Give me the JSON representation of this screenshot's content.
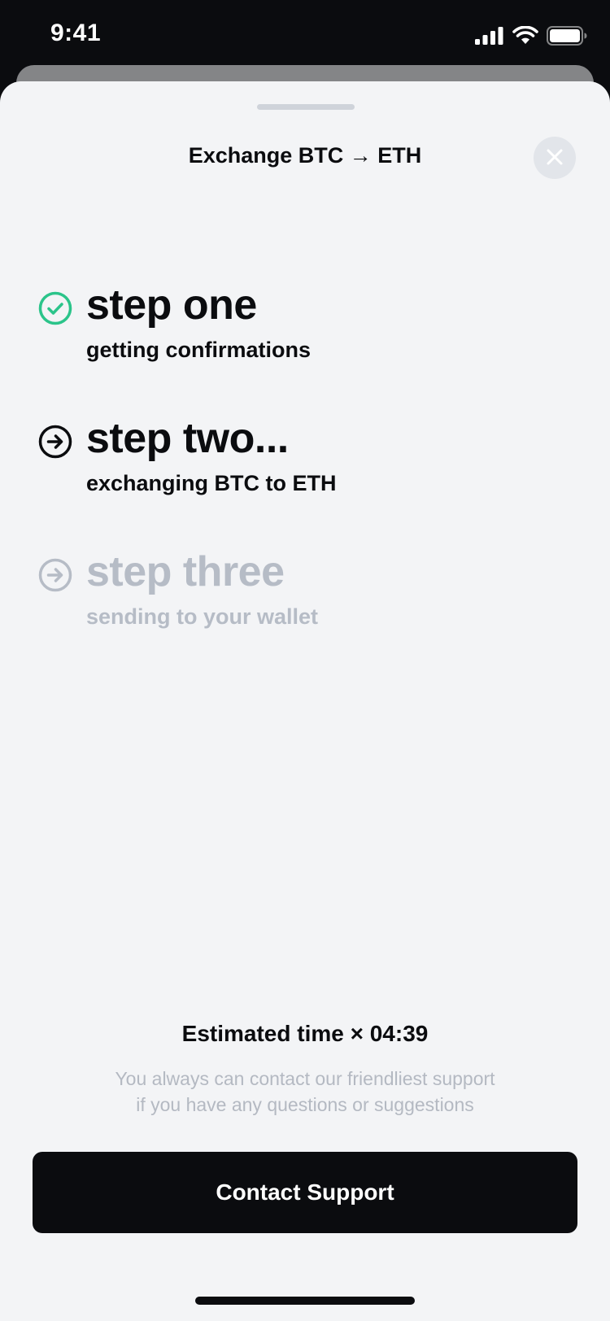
{
  "status_bar": {
    "time": "9:41",
    "icons": [
      "cellular-signal-icon",
      "wifi-icon",
      "battery-icon"
    ]
  },
  "sheet": {
    "title": "Exchange BTC → ETH",
    "close_icon": "close-icon"
  },
  "steps": [
    {
      "title": "step one",
      "subtitle": "getting confirmations",
      "state": "done",
      "icon": "check-circle-icon",
      "color": "#2bc48a"
    },
    {
      "title": "step two...",
      "subtitle": "exchanging BTC to ETH",
      "state": "active",
      "icon": "arrow-right-circle-icon",
      "color": "#0b0c0f"
    },
    {
      "title": "step three",
      "subtitle": "sending to your wallet",
      "state": "pending",
      "icon": "arrow-right-circle-icon",
      "color": "#b6bcc6"
    }
  ],
  "footer": {
    "estimate": "Estimated time × 04:39",
    "support_note_line1": "You always can contact our friendliest support",
    "support_note_line2": "if you have any questions or suggestions",
    "contact_button_label": "Contact Support"
  },
  "colors": {
    "background": "#f3f4f6",
    "primary": "#0b0c0f",
    "success": "#2bc48a",
    "muted": "#b6bcc6"
  }
}
